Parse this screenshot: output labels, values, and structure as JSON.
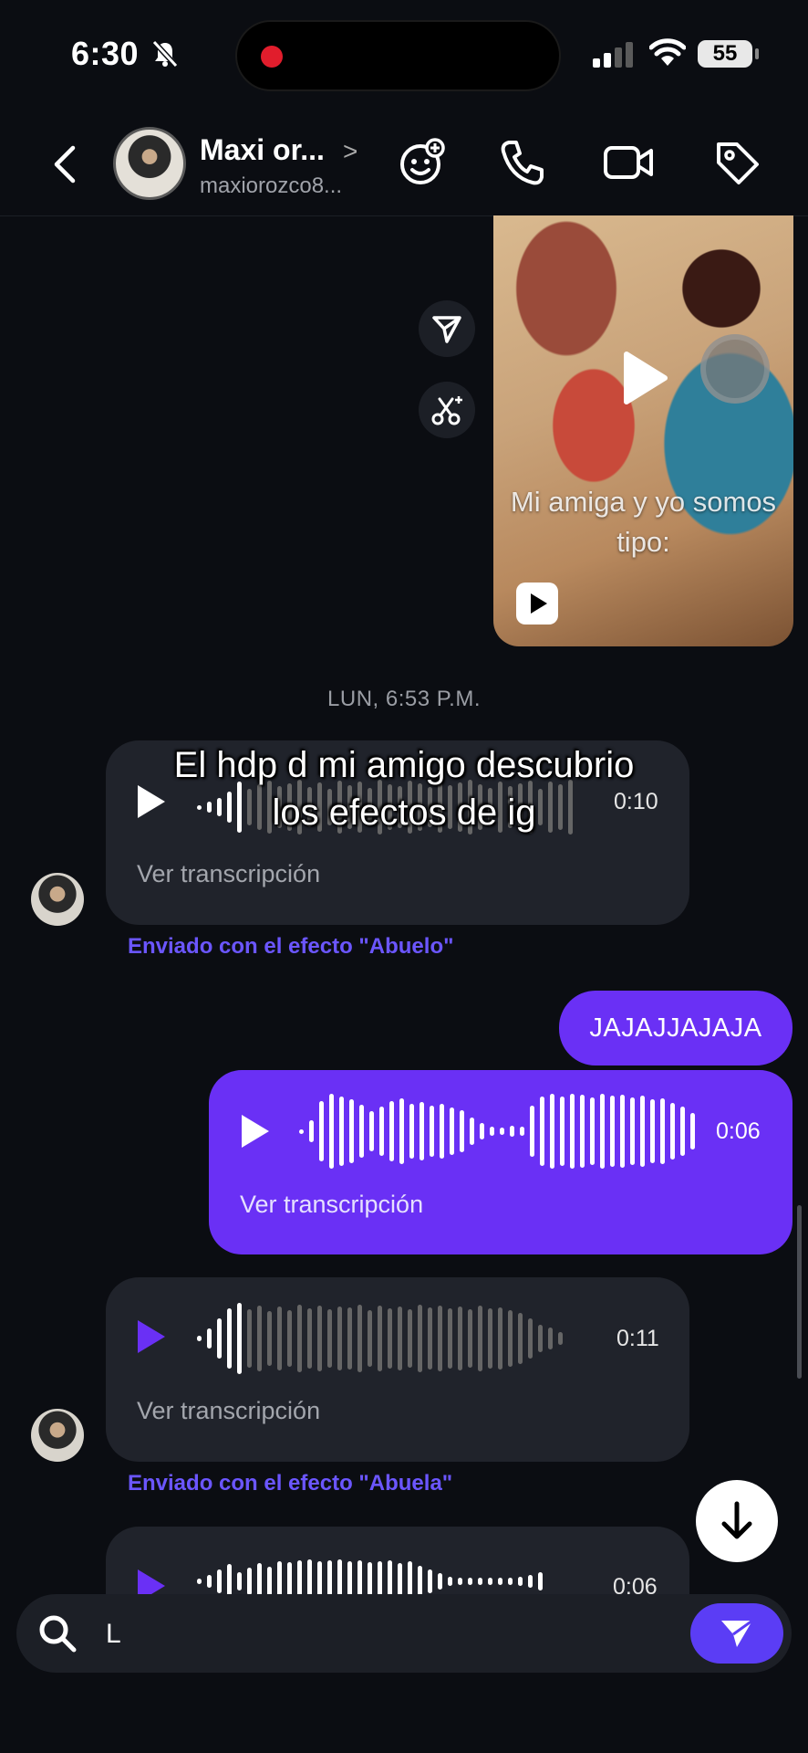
{
  "status_bar": {
    "time": "6:30",
    "battery": "55"
  },
  "header": {
    "contact_name": "Maxi or...",
    "username": "maxiorozco8...",
    "chevron": ">"
  },
  "media": {
    "caption": "Mi amiga y yo somos tipo:"
  },
  "timestamp": "LUN, 6:53 P.M.",
  "overlay_text": [
    "El hdp d mi amigo descubrio",
    "los efectos de ig"
  ],
  "messages": [
    {
      "sender": "contact",
      "type": "voice",
      "duration": "0:10",
      "transcript_label": "Ver transcripción",
      "effect_note": "Enviado con el efecto \"Abuelo\""
    },
    {
      "sender": "me",
      "type": "text",
      "text": "JAJAJJAJAJA"
    },
    {
      "sender": "me",
      "type": "voice",
      "duration": "0:06",
      "transcript_label": "Ver transcripción"
    },
    {
      "sender": "contact",
      "type": "voice",
      "duration": "0:11",
      "transcript_label": "Ver transcripción",
      "effect_note": "Enviado con el efecto \"Abuela\""
    },
    {
      "sender": "contact",
      "type": "voice",
      "duration": "0:06"
    }
  ],
  "composer": {
    "value": "L"
  },
  "colors": {
    "accent": "#6a30f5",
    "effect_note": "#6b56ff",
    "incoming_bubble": "#20232b",
    "background": "#0b0d12"
  },
  "icons": [
    "mute-icon",
    "signal-icon",
    "wifi-icon",
    "back-icon",
    "sticker-icon",
    "phone-icon",
    "video-icon",
    "tag-icon",
    "share-icon",
    "scissors-icon",
    "play-icon",
    "arrow-down-icon",
    "search-icon",
    "send-icon"
  ]
}
